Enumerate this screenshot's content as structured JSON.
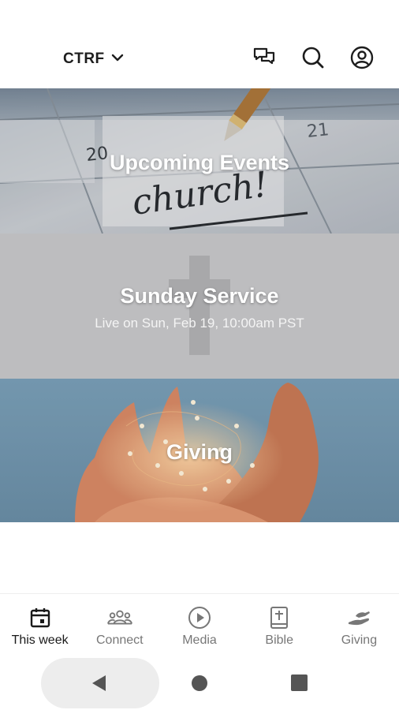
{
  "header": {
    "org_name": "CTRF",
    "icons": [
      "chevron-down-icon",
      "chat-icon",
      "search-icon",
      "account-icon"
    ]
  },
  "cards": [
    {
      "title": "Upcoming Events",
      "image": "calendar-church-photo"
    },
    {
      "title": "Sunday Service",
      "subtitle": "Live on Sun, Feb 19, 10:00am PST",
      "image": "cross-background"
    },
    {
      "title": "Giving",
      "image": "hands-lights-photo"
    }
  ],
  "bottom_nav": {
    "active": "This week",
    "items": [
      {
        "label": "This week",
        "icon": "calendar-icon"
      },
      {
        "label": "Connect",
        "icon": "group-icon"
      },
      {
        "label": "Media",
        "icon": "play-icon"
      },
      {
        "label": "Bible",
        "icon": "bible-icon"
      },
      {
        "label": "Giving",
        "icon": "giving-hand-icon"
      }
    ]
  },
  "system_nav": {
    "icons": [
      "back-icon",
      "home-icon",
      "recents-icon"
    ]
  },
  "colors": {
    "accent_text": "#1a1a1a",
    "inactive_text": "#777777",
    "service_bg": "#bdbdbf",
    "giving_sky": "#6f95ad",
    "hand_tone": "#d88a66"
  }
}
